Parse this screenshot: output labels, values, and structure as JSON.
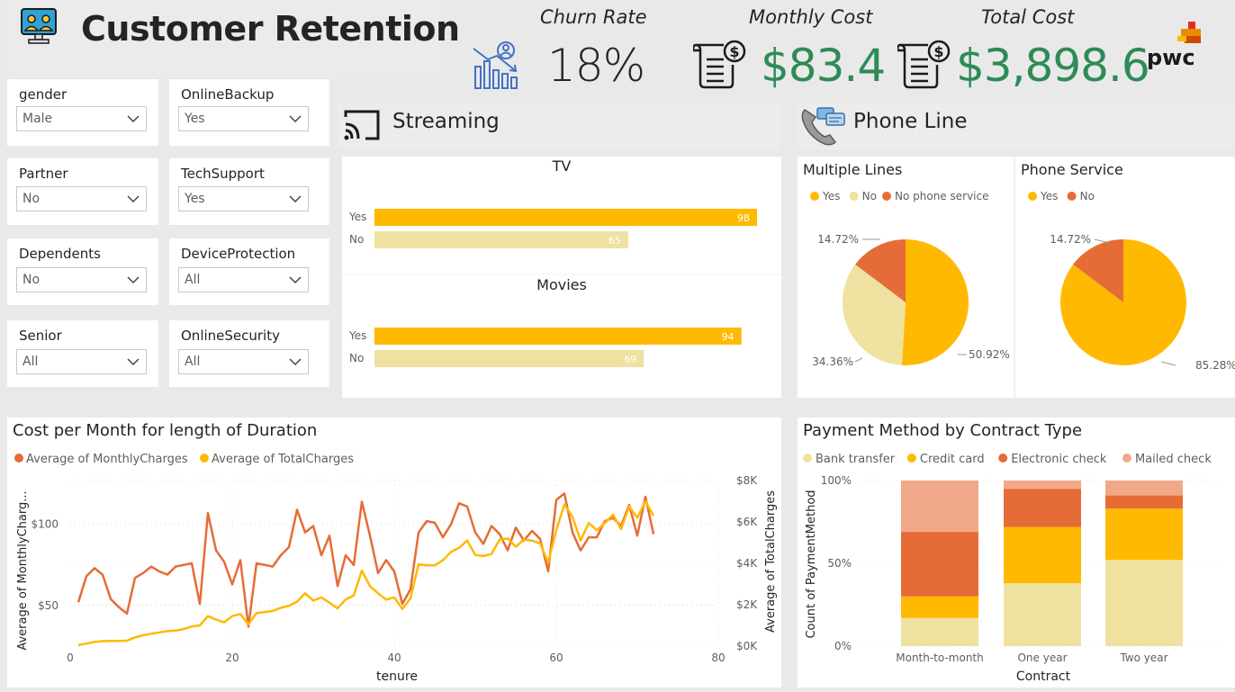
{
  "header": {
    "title": "Customer Retention"
  },
  "kpis": {
    "churn": {
      "label": "Churn Rate",
      "value": "18%"
    },
    "monthly": {
      "label": "Monthly Cost",
      "value": "$83.4"
    },
    "total": {
      "label": "Total Cost",
      "value": "$3,898.6"
    }
  },
  "brand": "pwc",
  "colors": {
    "dark_orange": "#E66C37",
    "gold": "#FFB900",
    "light": "#EFE1A0",
    "peach": "#F0A988",
    "green": "#2e8b57"
  },
  "slicers": [
    {
      "label": "gender",
      "value": "Male"
    },
    {
      "label": "OnlineBackup",
      "value": "Yes"
    },
    {
      "label": "Partner",
      "value": "No"
    },
    {
      "label": "TechSupport",
      "value": "Yes"
    },
    {
      "label": "Dependents",
      "value": "No"
    },
    {
      "label": "DeviceProtection",
      "value": "All"
    },
    {
      "label": "Senior",
      "value": "All"
    },
    {
      "label": "OnlineSecurity",
      "value": "All"
    }
  ],
  "sections": {
    "streaming": "Streaming",
    "phone": "Phone Line"
  },
  "chart_data": [
    {
      "type": "bar",
      "title": "TV",
      "orientation": "horizontal",
      "categories": [
        "Yes",
        "No"
      ],
      "values": [
        98,
        65
      ]
    },
    {
      "type": "bar",
      "title": "Movies",
      "orientation": "horizontal",
      "categories": [
        "Yes",
        "No"
      ],
      "values": [
        94,
        69
      ]
    },
    {
      "type": "pie",
      "title": "Multiple Lines",
      "legend": [
        "Yes",
        "No",
        "No phone service"
      ],
      "values": [
        50.92,
        34.36,
        14.72
      ],
      "labels": [
        "50.92%",
        "34.36%",
        "14.72%"
      ],
      "legend_position": "top-left"
    },
    {
      "type": "pie",
      "title": "Phone Service",
      "legend": [
        "Yes",
        "No"
      ],
      "values": [
        85.28,
        14.72
      ],
      "labels": [
        "85.28%",
        "14.72%"
      ],
      "legend_position": "top-left"
    },
    {
      "type": "line",
      "title": "Cost per Month for length of Duration",
      "xlabel": "tenure",
      "ylabel": "Average of MonthlyCharg...",
      "y2label": "Average of TotalCharges",
      "xlim": [
        0,
        80
      ],
      "xticks": [
        "0",
        "20",
        "40",
        "60",
        "80"
      ],
      "ylim": [
        25,
        127
      ],
      "yticks": [
        "$50",
        "$100"
      ],
      "y2lim": [
        0,
        8000
      ],
      "y2ticks": [
        "$0K",
        "$2K",
        "$4K",
        "$6K",
        "$8K"
      ],
      "grid": true,
      "legend_position": "top-left",
      "series": [
        {
          "name": "Average of MonthlyCharges",
          "axis": "left",
          "x": [
            1,
            2,
            3,
            4,
            5,
            6,
            7,
            8,
            9,
            10,
            11,
            12,
            13,
            14,
            15,
            16,
            17,
            18,
            19,
            20,
            21,
            22,
            23,
            24,
            25,
            26,
            27,
            28,
            29,
            30,
            31,
            32,
            33,
            34,
            35,
            36,
            37,
            38,
            39,
            40,
            41,
            42,
            43,
            44,
            45,
            46,
            47,
            48,
            49,
            50,
            51,
            52,
            53,
            54,
            55,
            56,
            57,
            58,
            59,
            60,
            61,
            62,
            63,
            64,
            65,
            66,
            67,
            68,
            69,
            70,
            71,
            72
          ],
          "y": [
            52,
            68,
            73,
            69,
            54,
            49,
            45,
            67,
            70,
            74,
            71,
            69,
            74,
            75,
            76,
            51,
            107,
            84,
            77,
            63,
            78,
            37,
            76,
            75,
            74,
            81,
            86,
            109,
            95,
            99,
            81,
            93,
            62,
            81,
            75,
            114,
            93,
            70,
            78,
            71,
            51,
            60,
            95,
            102,
            101,
            92,
            100,
            113,
            111,
            95,
            88,
            99,
            94,
            84,
            98,
            90,
            96,
            91,
            71,
            115,
            119,
            95,
            84,
            92,
            92,
            102,
            104,
            99,
            112,
            93,
            117,
            94
          ]
        },
        {
          "name": "Average of TotalCharges",
          "axis": "right",
          "x": [
            1,
            2,
            3,
            4,
            5,
            6,
            7,
            8,
            9,
            10,
            11,
            12,
            13,
            14,
            15,
            16,
            17,
            18,
            19,
            20,
            21,
            22,
            23,
            24,
            25,
            26,
            27,
            28,
            29,
            30,
            31,
            32,
            33,
            34,
            35,
            36,
            37,
            38,
            39,
            40,
            41,
            42,
            43,
            44,
            45,
            46,
            47,
            48,
            49,
            50,
            51,
            52,
            53,
            54,
            55,
            56,
            57,
            58,
            59,
            60,
            61,
            62,
            63,
            64,
            65,
            66,
            67,
            68,
            69,
            70,
            71,
            72
          ],
          "y": [
            50,
            120,
            200,
            240,
            250,
            250,
            260,
            420,
            520,
            600,
            660,
            720,
            750,
            820,
            950,
            1000,
            1450,
            1280,
            1150,
            1450,
            1550,
            1050,
            1600,
            1650,
            1700,
            1850,
            1950,
            2150,
            2550,
            2200,
            2350,
            2100,
            1820,
            2250,
            2450,
            3650,
            2900,
            2550,
            2250,
            2350,
            1800,
            2300,
            3950,
            3900,
            3900,
            4150,
            4550,
            4750,
            5100,
            4400,
            4350,
            4450,
            5150,
            5200,
            4800,
            5150,
            5100,
            4950,
            4050,
            5600,
            6850,
            6250,
            5100,
            5950,
            5600,
            5950,
            6350,
            5650,
            6750,
            6200,
            7000,
            6300
          ]
        }
      ]
    },
    {
      "type": "bar",
      "title": "Payment Method by Contract Type",
      "stacked": "100%",
      "xlabel": "Contract",
      "ylabel": "Count of PaymentMethod",
      "yticks": [
        "0%",
        "50%",
        "100%"
      ],
      "categories": [
        "Month-to-month",
        "One year",
        "Two year"
      ],
      "legend_position": "top-left",
      "series": [
        {
          "name": "Bank transfer",
          "values": [
            17,
            38,
            52
          ]
        },
        {
          "name": "Credit card",
          "values": [
            13,
            34,
            31
          ]
        },
        {
          "name": "Electronic check",
          "values": [
            39,
            23,
            8
          ]
        },
        {
          "name": "Mailed check",
          "values": [
            31,
            5,
            9
          ]
        }
      ]
    }
  ]
}
